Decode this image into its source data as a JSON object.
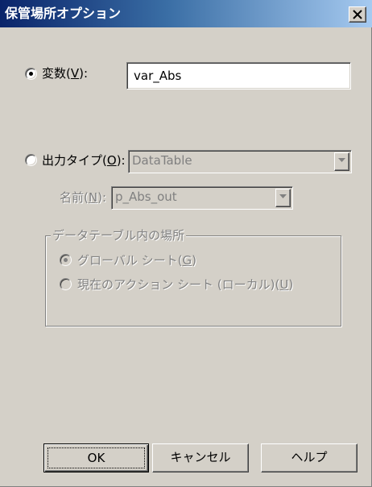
{
  "window": {
    "title": "保管場所オプション",
    "close_glyph": "×"
  },
  "variable": {
    "label": "変数",
    "mnemonic": "V",
    "suffix": ":",
    "value": "var_Abs",
    "selected": true
  },
  "output_type": {
    "label": "出力タイプ",
    "mnemonic": "O",
    "suffix": ":",
    "value": "DataTable",
    "selected": false
  },
  "name": {
    "label": "名前",
    "mnemonic": "N",
    "suffix": ":",
    "value": "p_Abs_out"
  },
  "location_group": {
    "legend": "データテーブル内の場所",
    "options": [
      {
        "label": "グローバル シート",
        "mnemonic": "G",
        "selected": true
      },
      {
        "label": "現在のアクション シート (ローカル)",
        "mnemonic": "U",
        "selected": false
      }
    ]
  },
  "buttons": {
    "ok": "OK",
    "cancel": "キャンセル",
    "help": "ヘルプ"
  },
  "icons": {
    "close": "close-icon",
    "dropdown": "chevron-down-icon",
    "radio": "radio-dot-icon"
  },
  "colors": {
    "face": "#d4d0c8",
    "title_start": "#0a246a",
    "title_end": "#a6caf0",
    "disabled_text": "#808080"
  }
}
